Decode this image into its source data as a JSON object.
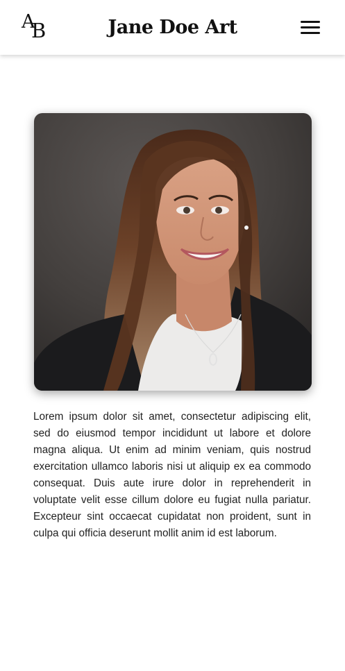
{
  "header": {
    "logo": {
      "letter_top": "A",
      "letter_bottom": "B"
    },
    "title": "Jane Doe Art",
    "menu_icon": "hamburger-menu-icon"
  },
  "profile": {
    "photo_subject": "portrait-photo",
    "bio": "Lorem ipsum dolor sit amet, consectetur adipiscing elit, sed do eiusmod tempor incididunt ut labore et dolore magna aliqua. Ut enim ad minim veniam, quis nostrud exercitation ullamco laboris nisi ut aliquip ex ea commodo consequat. Duis aute irure dolor in reprehenderit in voluptate velit esse cillum dolore eu fugiat nulla pariatur. Excepteur sint occaecat cupidatat non proident, sunt in culpa qui officia deserunt mollit anim id est laborum."
  },
  "colors": {
    "text": "#111111",
    "background": "#ffffff",
    "photo_backdrop": "#4a4644"
  }
}
